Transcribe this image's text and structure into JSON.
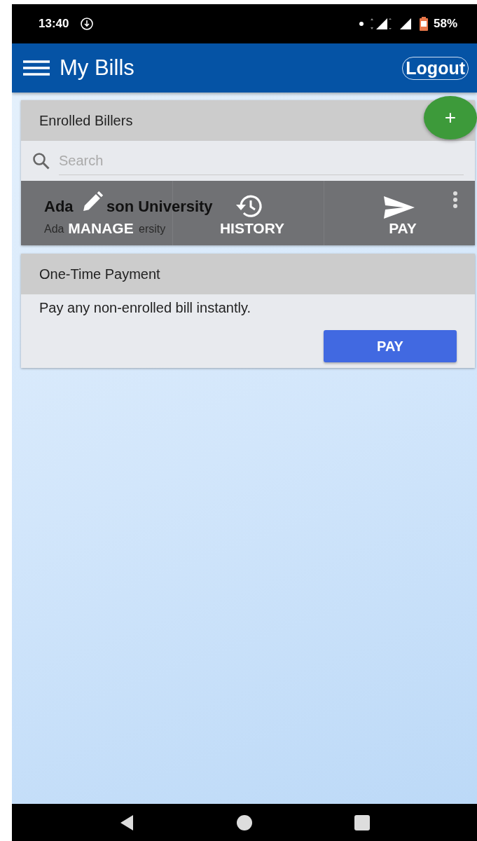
{
  "status_bar": {
    "time": "13:40",
    "battery": "58%"
  },
  "app_bar": {
    "title": "My Bills",
    "logout": "Logout"
  },
  "enrolled_billers": {
    "title": "Enrolled Billers",
    "add_button": "+",
    "search": {
      "placeholder": "Search"
    },
    "billers": [
      {
        "name_fragments": [
          "Ada",
          "son University"
        ],
        "subtitle_fragments": [
          "Ada",
          "ersity"
        ],
        "actions": [
          {
            "label": "MANAGE",
            "kind": "edit"
          },
          {
            "label": "HISTORY",
            "kind": "history"
          },
          {
            "label": "PAY",
            "kind": "pay"
          }
        ]
      }
    ]
  },
  "one_time_payment": {
    "title": "One-Time Payment",
    "text": "Pay any non-enrolled bill instantly.",
    "button": "PAY"
  }
}
